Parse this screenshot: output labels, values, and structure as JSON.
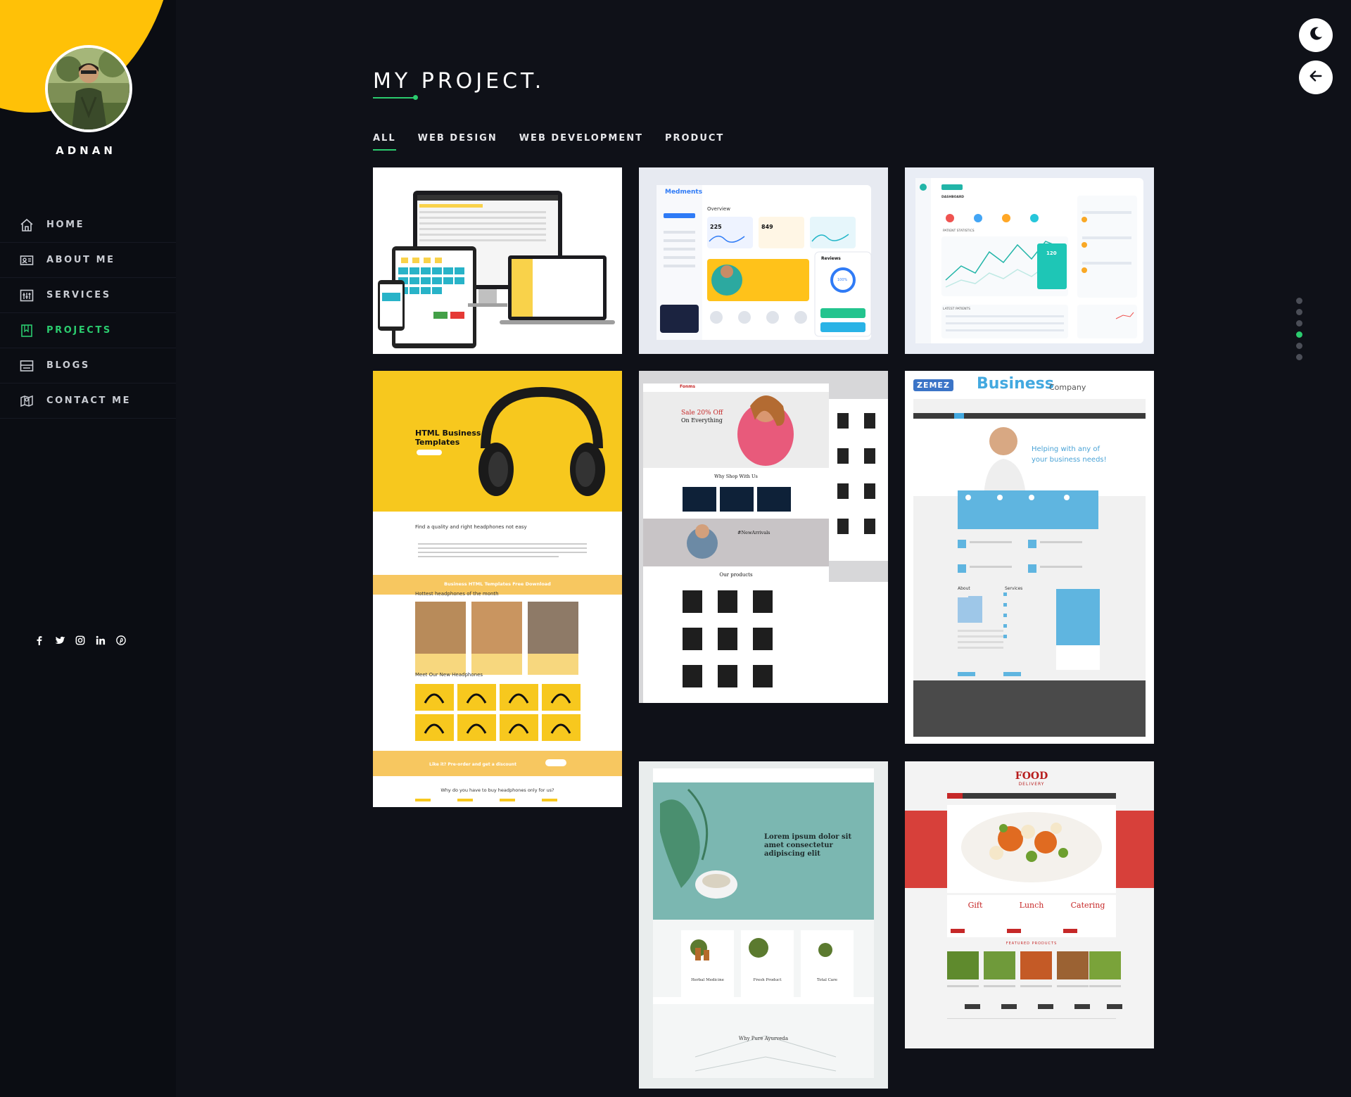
{
  "profile": {
    "name": "ADNAN"
  },
  "nav": [
    {
      "label": "HOME",
      "icon": "home-icon"
    },
    {
      "label": "ABOUT ME",
      "icon": "id-card-icon"
    },
    {
      "label": "SERVICES",
      "icon": "services-icon"
    },
    {
      "label": "PROJECTS",
      "icon": "bookmark-icon",
      "active": true
    },
    {
      "label": "BLOGS",
      "icon": "blog-icon"
    },
    {
      "label": "CONTACT ME",
      "icon": "map-icon"
    }
  ],
  "social": [
    "facebook-icon",
    "twitter-icon",
    "instagram-icon",
    "linkedin-icon",
    "pinterest-icon"
  ],
  "page": {
    "title": "MY PROJECT."
  },
  "tabs": [
    {
      "label": "ALL",
      "active": true
    },
    {
      "label": "WEB DESIGN"
    },
    {
      "label": "WEB DEVELOPMENT"
    },
    {
      "label": "PRODUCT"
    }
  ],
  "projects": {
    "pos": {
      "thumb_label": "Point of sale responsive devices"
    },
    "medments": {
      "brand": "Medments",
      "heading": "Overview",
      "stats": [
        "225",
        "849"
      ],
      "panel": "Reviews",
      "score": "100%"
    },
    "dashboard": {
      "heading": "DASHBOARD",
      "section": "PATIENT STATISTICS",
      "value": "120",
      "list": "LATEST PATIENTS"
    },
    "headphones": {
      "headline": "HTML Business Templates",
      "intro": "Find a quality and right headphones not easy",
      "banner": "Business HTML Templates Free Download",
      "section1": "Hottest headphones of the month",
      "section2": "Meet Our New Headphones",
      "promo": "Like it? Pre-order and get a discount",
      "question": "Why do you have to buy headphones only for us?"
    },
    "fashion": {
      "brand": "Fonms",
      "promo1": "Sale 20% Off",
      "promo2": "On Everything",
      "why": "Why Shop With Us",
      "arrivals": "#NewArrivals",
      "products": "Our products"
    },
    "business": {
      "badge": "ZEMEZ",
      "title": "Business",
      "subtitle": "Company",
      "tagline1": "Helping with any of",
      "tagline2": "your business needs!",
      "about": "About",
      "services": "Services"
    },
    "ayurveda": {
      "headline1": "Lorem ipsum dolor sit",
      "headline2": "amet consectetur",
      "headline3": "adipiscing elit",
      "products": [
        "Herbal Medicine",
        "Fresh Product",
        "Total Care"
      ],
      "why": "Why Pure Ayurveda"
    },
    "food": {
      "title": "FOOD",
      "subtitle": "DELIVERY",
      "boxes": [
        "Gift",
        "Lunch",
        "Catering"
      ],
      "section": "FEATURED PRODUCTS"
    }
  },
  "controls": {
    "theme": "moon-icon",
    "back": "arrow-left-icon",
    "dots": 6,
    "active_dot": 4
  }
}
